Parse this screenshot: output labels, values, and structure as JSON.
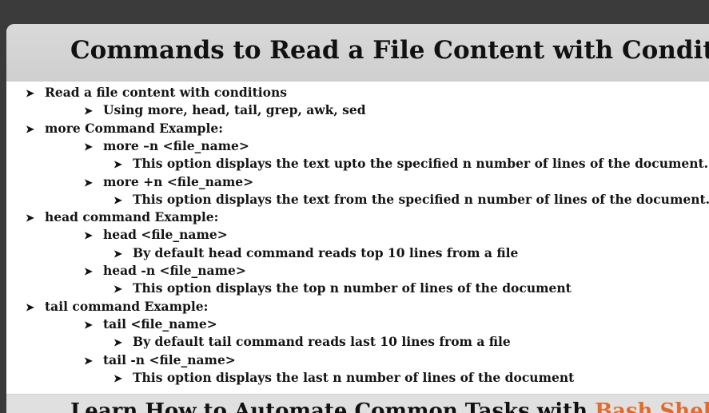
{
  "title": "Commands to Read a File Content with Conditio",
  "lines": [
    {
      "level": 0,
      "text": "Read a file content with conditions"
    },
    {
      "level": 1,
      "text": "Using more, head, tail, grep, awk, sed"
    },
    {
      "level": 0,
      "text": "more Command Example:"
    },
    {
      "level": 1,
      "text": "more –n <file_name>"
    },
    {
      "level": 2,
      "text": "This option displays the text  upto the specified n number of lines of the document."
    },
    {
      "level": 1,
      "text": "more +n  <file_name>"
    },
    {
      "level": 2,
      "text": "This option displays the text from the specified n number of lines of the document."
    },
    {
      "level": 0,
      "text": "head command Example:"
    },
    {
      "level": 1,
      "text": "head <file_name>"
    },
    {
      "level": 2,
      "text": "By default head command reads top 10 lines from a file"
    },
    {
      "level": 1,
      "text": "head -n <file_name>"
    },
    {
      "level": 2,
      "text": "This option displays the top n number of lines of the document"
    },
    {
      "level": 0,
      "text": "tail command Example:"
    },
    {
      "level": 1,
      "text": "tail <file_name>"
    },
    {
      "level": 2,
      "text": "By default tail command reads last 10 lines from a file"
    },
    {
      "level": 1,
      "text": "tail -n <file_name>"
    },
    {
      "level": 2,
      "text": "This option displays the last n number of lines of the document"
    }
  ],
  "footer": {
    "text_part": "Learn How to Automate Common Tasks with",
    "accent_part": "Bash Shell Scripti"
  },
  "bullet_glyph": "➤",
  "colors": {
    "title_bar": "#d4d4d4",
    "text": "#141414",
    "footer_accent": "#e46a2a"
  }
}
